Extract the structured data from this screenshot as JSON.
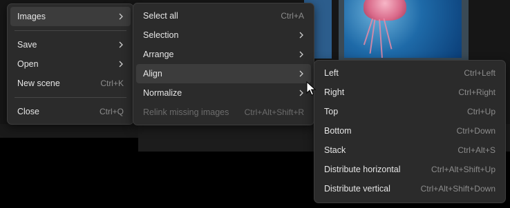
{
  "main_menu": {
    "items": [
      {
        "label": "Images",
        "shortcut": "",
        "submenu": true,
        "active": true
      },
      {
        "label": "Save",
        "shortcut": "",
        "submenu": true
      },
      {
        "label": "Open",
        "shortcut": "",
        "submenu": true
      },
      {
        "label": "New scene",
        "shortcut": "Ctrl+K",
        "submenu": false
      },
      {
        "label": "Close",
        "shortcut": "Ctrl+Q",
        "submenu": false
      }
    ]
  },
  "images_menu": {
    "items": [
      {
        "label": "Select all",
        "shortcut": "Ctrl+A"
      },
      {
        "label": "Selection",
        "shortcut": ""
      },
      {
        "label": "Arrange",
        "shortcut": ""
      },
      {
        "label": "Align",
        "shortcut": ""
      },
      {
        "label": "Normalize",
        "shortcut": ""
      },
      {
        "label": "Relink missing images",
        "shortcut": "Ctrl+Alt+Shift+R"
      }
    ]
  },
  "align_menu": {
    "items": [
      {
        "label": "Left",
        "shortcut": "Ctrl+Left"
      },
      {
        "label": "Right",
        "shortcut": "Ctrl+Right"
      },
      {
        "label": "Top",
        "shortcut": "Ctrl+Up"
      },
      {
        "label": "Bottom",
        "shortcut": "Ctrl+Down"
      },
      {
        "label": "Stack",
        "shortcut": "Ctrl+Alt+S"
      },
      {
        "label": "Distribute horizontal",
        "shortcut": "Ctrl+Alt+Shift+Up"
      },
      {
        "label": "Distribute vertical",
        "shortcut": "Ctrl+Alt+Shift+Down"
      }
    ]
  },
  "colors": {
    "menu_bg": "#2b2b2b",
    "highlight": "#3c3c3c",
    "shortcut_text": "#8c8c8c"
  }
}
